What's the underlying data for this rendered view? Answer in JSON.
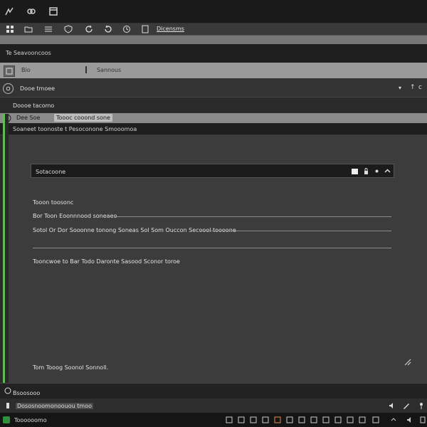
{
  "window": {
    "icons": [
      "signal-icon",
      "link-icon",
      "window-icon"
    ]
  },
  "toolbar": {
    "icons": [
      "grid-icon",
      "folder-icon",
      "list-icon",
      "shield-icon",
      "refresh-icon",
      "rotate-icon",
      "history-icon",
      "page-icon"
    ],
    "text": "Dicensms"
  },
  "pathbar": {
    "text": "Te Seavooncoos"
  },
  "addressbar": {
    "left_text": "Bio",
    "right_text": "Sannous"
  },
  "dropdown": {
    "label": "Dooe tmoee",
    "arrow": "▾",
    "right_a": "↑",
    "right_b": "c"
  },
  "section": {
    "label": "Doooe tacomo"
  },
  "tabs": [
    {
      "label": "Dee Soe",
      "active": false
    },
    {
      "label": "Toooc cooond sone",
      "active": true
    }
  ],
  "infobar": {
    "text": "Soaneet toonoste t Pesoconone Smooomoa"
  },
  "search": {
    "value": "Sotacoone",
    "placeholder": ""
  },
  "content": {
    "heading": "Tooon toosonc",
    "line1": "Bor Toon Eoonnnood soneaeo",
    "line2": "Sotol Or Dor Sooonne tonong Soneas Sol Som Ouccon Secoool toooone",
    "line3": "Tooncwoe to Bar Todo Daronte Sasood Sconor toroe",
    "footer": "Tom Tooog Soonol Sonnoll."
  },
  "bottompanel": {
    "text": "Bsoosooo"
  },
  "statusrow": {
    "text": "Dososnoomonoouou tmoo"
  },
  "taskbar": {
    "text": "Toooooomo"
  },
  "colors": {
    "accent": "#63b95a",
    "background": "#2b2b2b",
    "panel": "#3c3c3c",
    "highlight": "#e28a4a"
  }
}
